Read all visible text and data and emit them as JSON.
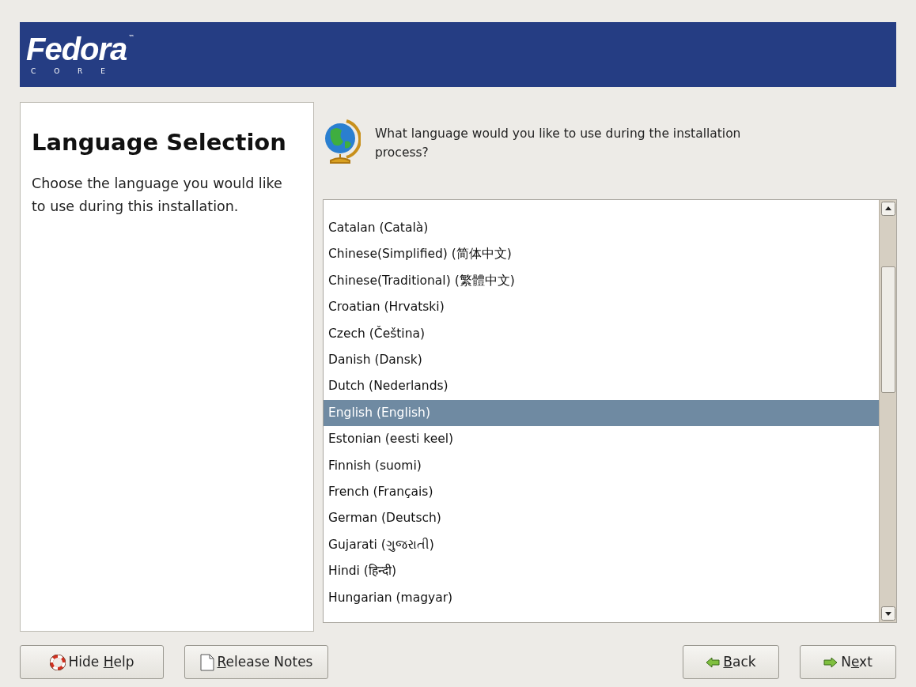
{
  "banner": {
    "logo": "Fedora",
    "trademark": "™",
    "subtitle": "C O R E"
  },
  "help": {
    "title": "Language Selection",
    "body": "Choose the language you would like to use during this installation."
  },
  "prompt": "What language would you like to use during the installation process?",
  "languages": [
    {
      "label": "Catalan (Català)",
      "selected": false
    },
    {
      "label": "Chinese(Simplified) (简体中文)",
      "selected": false
    },
    {
      "label": "Chinese(Traditional) (繁體中文)",
      "selected": false
    },
    {
      "label": "Croatian (Hrvatski)",
      "selected": false
    },
    {
      "label": "Czech (Čeština)",
      "selected": false
    },
    {
      "label": "Danish (Dansk)",
      "selected": false
    },
    {
      "label": "Dutch (Nederlands)",
      "selected": false
    },
    {
      "label": "English (English)",
      "selected": true
    },
    {
      "label": "Estonian (eesti keel)",
      "selected": false
    },
    {
      "label": "Finnish (suomi)",
      "selected": false
    },
    {
      "label": "French (Français)",
      "selected": false
    },
    {
      "label": "German (Deutsch)",
      "selected": false
    },
    {
      "label": "Gujarati (ગુજરાતી)",
      "selected": false
    },
    {
      "label": "Hindi (हिन्दी)",
      "selected": false
    },
    {
      "label": "Hungarian (magyar)",
      "selected": false
    }
  ],
  "buttons": [
    {
      "kind": "help",
      "before": "Hide ",
      "mnemonic": "H",
      "after": "elp"
    },
    {
      "kind": "notes",
      "mnemonic": "R",
      "after": "elease Notes"
    },
    {
      "kind": "back",
      "mnemonic": "B",
      "after": "ack"
    },
    {
      "kind": "next",
      "before": "N",
      "mnemonic": "e",
      "after": "xt"
    }
  ]
}
